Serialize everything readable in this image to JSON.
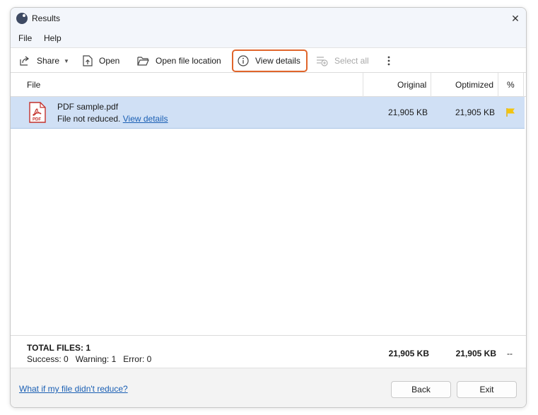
{
  "window": {
    "title": "Results",
    "close_glyph": "✕"
  },
  "menu": [
    "File",
    "Help"
  ],
  "toolbar": {
    "share": "Share",
    "open": "Open",
    "open_location": "Open file location",
    "view_details": "View details",
    "select_all": "Select all"
  },
  "table": {
    "columns": {
      "file": "File",
      "original": "Original",
      "optimized": "Optimized",
      "percent": "%"
    },
    "rows": [
      {
        "name": "PDF sample.pdf",
        "status": "File not reduced.",
        "link": "View details",
        "original": "21,905 KB",
        "optimized": "21,905 KB",
        "icon_label": "PDF",
        "flag_color": "#f2c40f"
      }
    ]
  },
  "totals": {
    "label": "TOTAL FILES: 1",
    "summary": "Success: 0   Warning: 1   Error: 0",
    "original": "21,905 KB",
    "optimized": "21,905 KB",
    "percent": "--"
  },
  "footer": {
    "help_link": "What if my file didn't reduce?",
    "back": "Back",
    "exit": "Exit"
  },
  "colors": {
    "accent_highlight": "#e0652b",
    "link": "#1a5fb4",
    "selected_row": "#d0e0f5"
  }
}
